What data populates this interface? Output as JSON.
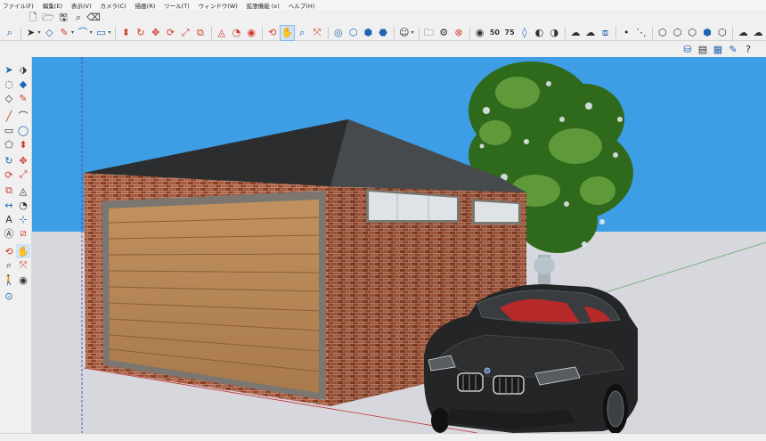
{
  "menu": {
    "items": [
      "ファイル(F)",
      "編集(E)",
      "表示(V)",
      "カメラ(C)",
      "描画(R)",
      "ツール(T)",
      "ウィンドウ(W)",
      "拡張機能 (x)",
      "ヘルプ(H)"
    ]
  },
  "toolbar": {
    "animation_speed_50": "50",
    "animation_speed_75": "75"
  },
  "colors": {
    "sky": "#3d9ee6",
    "ground": "#d6d8de",
    "brick": "#9a4a2e",
    "roof": "#3b3d3f",
    "door": "#b8885a",
    "door_frame": "#7b7670",
    "window": "#dde3e7",
    "car": "#232526",
    "car_interior": "#b62a2a",
    "foliage": "#2f6a1c",
    "active_tool": "#cfe3f7"
  },
  "icons": {
    "left_toolbar": [
      "select-icon",
      "make-component-icon",
      "lasso-icon",
      "paint-bucket-icon",
      "eraser-icon",
      "pencil-icon",
      "line-icon",
      "arc-icon",
      "rectangle-icon",
      "circle-icon",
      "polygon-icon",
      "push-pull-icon",
      "follow-me-icon",
      "move-icon",
      "rotate-icon",
      "scale-icon",
      "offset-icon",
      "tape-measure-icon",
      "dimension-icon",
      "protractor-icon",
      "text-icon",
      "axes-icon",
      "3d-text-icon",
      "section-plane-icon",
      "orbit-icon",
      "pan-icon",
      "zoom-icon",
      "zoom-extents-icon",
      "walk-icon",
      "look-around-icon",
      "position-camera-icon"
    ]
  }
}
